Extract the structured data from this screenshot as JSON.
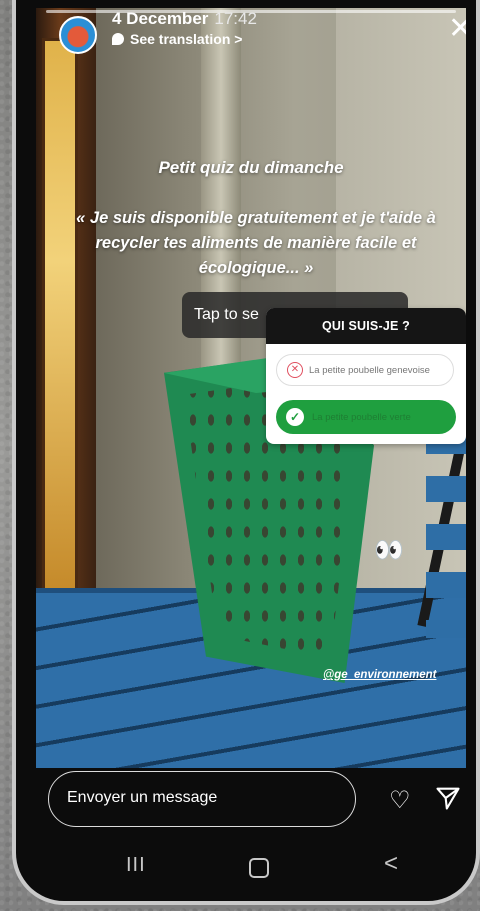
{
  "header": {
    "date": "4 December",
    "time": "17:42",
    "translate_label": "See translation >",
    "close_symbol": "✕"
  },
  "story": {
    "quiz_title": "Petit quiz du dimanche",
    "quote": "« Je suis disponible gratuitement et je t'aide à recycler tes aliments de manière facile et écologique... »",
    "tooltip": "Tap to se",
    "credit": "@ge_environnement",
    "emoji": "👀"
  },
  "quiz": {
    "question": "QUI SUIS-JE ?",
    "options": [
      {
        "label": "La petite poubelle genevoise",
        "state": "wrong"
      },
      {
        "label": "La petite poubelle verte",
        "state": "correct"
      }
    ]
  },
  "footer": {
    "message_placeholder": "Envoyer un message",
    "icons": [
      "heart-icon",
      "send-icon"
    ]
  },
  "nav": {
    "recent_symbol": "III",
    "back_symbol": "<"
  },
  "colors": {
    "correct": "#1f9f3f",
    "wrong": "#e04f5f",
    "table_blue": "#2f6fa8",
    "basket_green": "#1f8a52"
  }
}
